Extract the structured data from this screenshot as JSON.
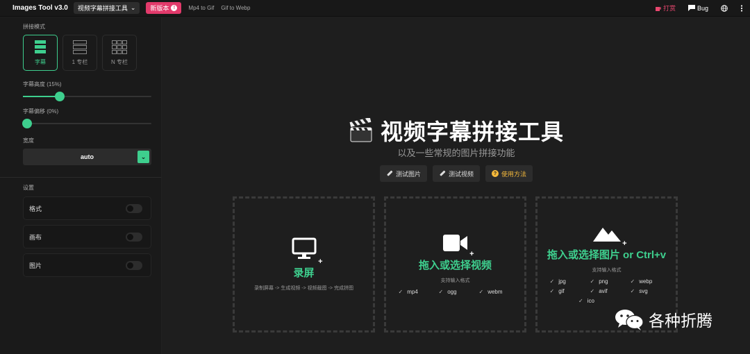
{
  "app": {
    "title": "Images Tool v3.0"
  },
  "header": {
    "tool_select": "视频字幕拼接工具",
    "new_version": "新版本",
    "links": [
      "Mp4 to Gif",
      "Gif to Webp"
    ],
    "reward": "打赏",
    "bug": "Bug"
  },
  "sidebar": {
    "mode_label": "拼接模式",
    "modes": [
      {
        "label": "字幕",
        "active": true
      },
      {
        "label": "1 专栏",
        "active": false
      },
      {
        "label": "N 专栏",
        "active": false
      }
    ],
    "subtitle_height_label": "字幕高度 (15%)",
    "subtitle_height_value": 0.15,
    "subtitle_offset_label": "字幕偏移 (0%)",
    "subtitle_offset_value": 0,
    "width_label": "宽度",
    "width_value": "auto",
    "settings_label": "设置",
    "settings": [
      {
        "label": "格式",
        "on": false
      },
      {
        "label": "画布",
        "on": false
      },
      {
        "label": "图片",
        "on": false
      }
    ]
  },
  "main": {
    "title": "视频字幕拼接工具",
    "subtitle": "以及一些常规的图片拼接功能",
    "buttons": {
      "test_image": "测试图片",
      "test_video": "测试视频",
      "help": "使用方法"
    },
    "record": {
      "title": "录屏",
      "desc": "录制屏幕 -> 生成视频 -> 视频截图 -> 完成拼图"
    },
    "video": {
      "title": "拖入或选择视频",
      "desc": "支持输入格式",
      "formats": [
        "mp4",
        "ogg",
        "webm"
      ]
    },
    "image": {
      "title": "拖入或选择图片 or Ctrl+v",
      "desc": "支持输入格式",
      "formats": [
        "jpg",
        "png",
        "webp",
        "gif",
        "avif",
        "svg",
        "ico"
      ]
    }
  },
  "watermark": {
    "text": "各种折腾"
  },
  "colors": {
    "accent": "#3ecf8e",
    "new_badge": "#e23a6b",
    "help": "#f5b93b"
  }
}
